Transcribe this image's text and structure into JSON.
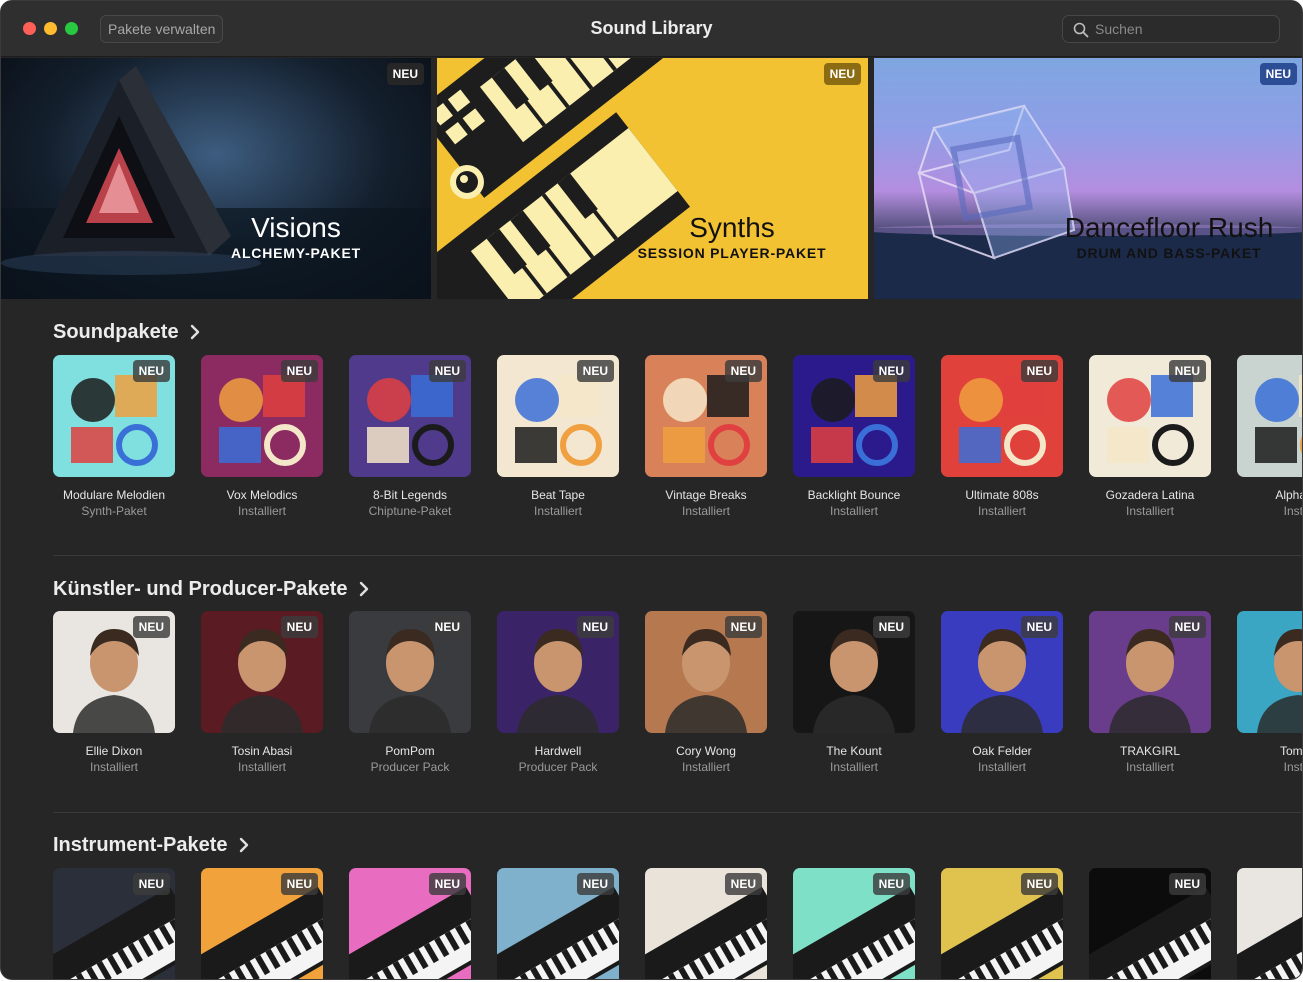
{
  "window": {
    "title": "Sound Library",
    "manage_button": "Pakete verwalten",
    "search_placeholder": "Suchen"
  },
  "badge_label": "NEU",
  "banners": [
    {
      "title": "Visions",
      "subtitle": "ALCHEMY-PAKET",
      "badge": "NEU"
    },
    {
      "title": "Synths",
      "subtitle": "SESSION PLAYER-PAKET",
      "badge": "NEU"
    },
    {
      "title": "Dancefloor Rush",
      "subtitle": "DRUM AND BASS-PAKET",
      "badge": "NEU"
    }
  ],
  "sections": [
    {
      "title": "Soundpakete",
      "items": [
        {
          "name": "Modulare Melodien",
          "sub": "Synth-Paket",
          "badge": "NEU",
          "bg": "#7fe0df"
        },
        {
          "name": "Vox Melodics",
          "sub": "Installiert",
          "badge": "NEU",
          "bg": "#8c2b62"
        },
        {
          "name": "8-Bit Legends",
          "sub": "Chiptune-Paket",
          "badge": "NEU",
          "bg": "#4f3a8c"
        },
        {
          "name": "Beat Tape",
          "sub": "Installiert",
          "badge": "NEU",
          "bg": "#f3e7d2"
        },
        {
          "name": "Vintage Breaks",
          "sub": "Installiert",
          "badge": "NEU",
          "bg": "#d9825a"
        },
        {
          "name": "Backlight Bounce",
          "sub": "Installiert",
          "badge": "NEU",
          "bg": "#2b1a8c"
        },
        {
          "name": "Ultimate 808s",
          "sub": "Installiert",
          "badge": "NEU",
          "bg": "#e0413a"
        },
        {
          "name": "Gozadera Latina",
          "sub": "Installiert",
          "badge": "NEU",
          "bg": "#f2ead8"
        },
        {
          "name": "Alpha W",
          "sub": "Instal",
          "badge": "",
          "bg": "#c9d3cf"
        }
      ]
    },
    {
      "title": "Künstler- und Producer-Pakete",
      "items": [
        {
          "name": "Ellie Dixon",
          "sub": "Installiert",
          "badge": "NEU",
          "bg": "#e9e6e1"
        },
        {
          "name": "Tosin Abasi",
          "sub": "Installiert",
          "badge": "NEU",
          "bg": "#5a1c22"
        },
        {
          "name": "PomPom",
          "sub": "Producer Pack",
          "badge": "NEU",
          "bg": "#3a3b3f"
        },
        {
          "name": "Hardwell",
          "sub": "Producer Pack",
          "badge": "NEU",
          "bg": "#3a2366"
        },
        {
          "name": "Cory Wong",
          "sub": "Installiert",
          "badge": "NEU",
          "bg": "#b6784f"
        },
        {
          "name": "The Kount",
          "sub": "Installiert",
          "badge": "NEU",
          "bg": "#161616"
        },
        {
          "name": "Oak Felder",
          "sub": "Installiert",
          "badge": "NEU",
          "bg": "#3a3cc0"
        },
        {
          "name": "TRAKGIRL",
          "sub": "Installiert",
          "badge": "NEU",
          "bg": "#6a3c8c"
        },
        {
          "name": "Tom M",
          "sub": "Instal",
          "badge": "",
          "bg": "#3aa6c4"
        }
      ]
    },
    {
      "title": "Instrument-Pakete",
      "items": [
        {
          "name": "",
          "sub": "",
          "badge": "NEU",
          "bg": "#2a2f3a"
        },
        {
          "name": "",
          "sub": "",
          "badge": "NEU",
          "bg": "#f2a23a"
        },
        {
          "name": "",
          "sub": "",
          "badge": "NEU",
          "bg": "#e86cc0"
        },
        {
          "name": "",
          "sub": "",
          "badge": "NEU",
          "bg": "#7fb0cc"
        },
        {
          "name": "",
          "sub": "",
          "badge": "NEU",
          "bg": "#e9e3da"
        },
        {
          "name": "",
          "sub": "",
          "badge": "NEU",
          "bg": "#7fe0c8"
        },
        {
          "name": "",
          "sub": "",
          "badge": "NEU",
          "bg": "#e0c24f"
        },
        {
          "name": "",
          "sub": "",
          "badge": "NEU",
          "bg": "#0c0c0c"
        },
        {
          "name": "",
          "sub": "",
          "badge": "",
          "bg": "#e9e6e1"
        }
      ]
    }
  ]
}
